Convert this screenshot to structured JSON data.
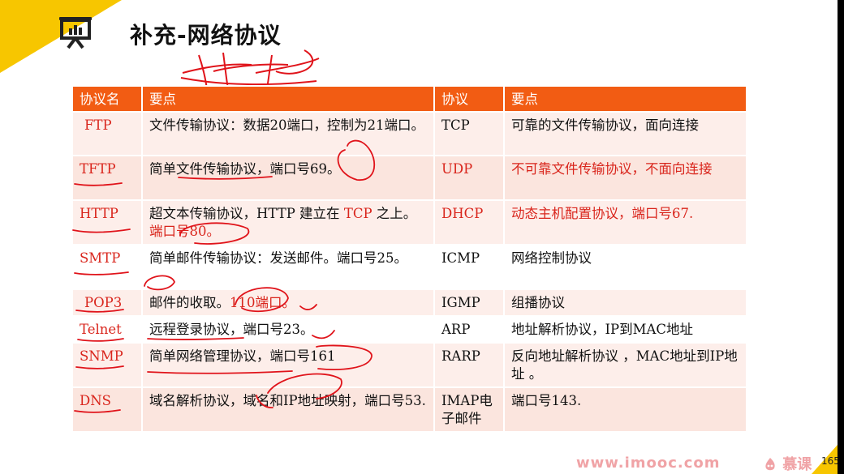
{
  "title": "补充-网络协议",
  "annotation_text": "http",
  "table": {
    "headers": [
      "协议名",
      "要点",
      "协议",
      "要点"
    ],
    "rows": [
      {
        "p1": "FTP",
        "d1": "文件传输协议：数据20端口，控制为21端口。",
        "p2": "TCP",
        "d2": "可靠的文件传输协议，面向连接"
      },
      {
        "p1": "TFTP",
        "d1": "简单文件传输协议，端口号69。",
        "p2": "UDP",
        "d2": "不可靠文件传输协议，不面向连接"
      },
      {
        "p1": "HTTP",
        "d1_a": "超文本传输协议，HTTP 建立在 ",
        "d1_b": "TCP",
        "d1_c": " 之上。",
        "d1_d": "端口号80。",
        "p2": "DHCP",
        "d2": "动态主机配置协议，端口号67."
      },
      {
        "p1": "SMTP",
        "d1": "简单邮件传输协议：发送邮件。端口号25。",
        "p2": "ICMP",
        "d2": "网络控制协议"
      },
      {
        "p1": "POP3",
        "d1_a": "邮件的收取。",
        "d1_b": "110端口。",
        "p2": "IGMP",
        "d2": "组播协议"
      },
      {
        "p1": "Telnet",
        "d1": "远程登录协议，端口号23。",
        "p2": "ARP",
        "d2": "地址解析协议，IP到MAC地址"
      },
      {
        "p1": "SNMP",
        "d1": "简单网络管理协议，端口号161",
        "p2": "RARP",
        "d2": "反向地址解析协议 ，MAC地址到IP地址 。"
      },
      {
        "p1": "DNS",
        "d1": "域名解析协议，域名和IP地址映射，端口号53.",
        "p2": "IMAP电子邮件",
        "d2": "端口号143."
      }
    ]
  },
  "footer": {
    "watermark": "www.imooc.com",
    "brand": "慕课",
    "page_number": "165"
  },
  "colors": {
    "header_bg": "#f25c13",
    "row_bg": "#fbe5de",
    "accent_yellow": "#f7c600",
    "text_red": "#d9251c",
    "ink_red": "#e0131a"
  },
  "icons": [
    "presenter-board-icon",
    "imooc-logo-icon"
  ]
}
